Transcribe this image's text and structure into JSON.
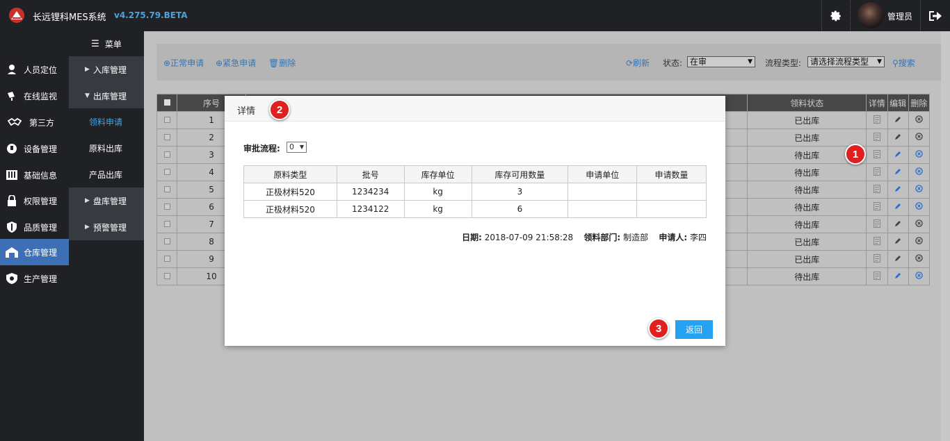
{
  "app": {
    "title": "长远锂科MES系统",
    "version": "v4.275.79.BETA",
    "user": "管理员"
  },
  "nav": [
    {
      "label": "人员定位",
      "icon": "person-pin-icon"
    },
    {
      "label": "在线监视",
      "icon": "monitor-icon"
    },
    {
      "label": "第三方",
      "icon": "handshake-icon"
    },
    {
      "label": "设备管理",
      "icon": "device-icon"
    },
    {
      "label": "基础信息",
      "icon": "columns-icon"
    },
    {
      "label": "权限管理",
      "icon": "lock-icon"
    },
    {
      "label": "品质管理",
      "icon": "shield-icon"
    },
    {
      "label": "仓库管理",
      "icon": "warehouse-icon"
    },
    {
      "label": "生产管理",
      "icon": "gear-shield-icon"
    }
  ],
  "submenu": {
    "header": "菜单",
    "groups": [
      {
        "label": "入库管理"
      },
      {
        "label": "出库管理"
      },
      {
        "label": "盘库管理"
      },
      {
        "label": "预警管理"
      }
    ],
    "children": [
      {
        "label": "领料申请"
      },
      {
        "label": "原料出库"
      },
      {
        "label": "产品出库"
      }
    ]
  },
  "toolbar": {
    "normal_apply": "正常申请",
    "urgent_apply": "紧急申请",
    "delete": "删除",
    "refresh": "刷新",
    "status_label": "状态:",
    "status_value": "在审",
    "flow_type_label": "流程类型:",
    "flow_type_value": "请选择流程类型",
    "search": "搜索"
  },
  "grid": {
    "headers": {
      "seq": "序号",
      "pick_status": "领料状态",
      "detail": "详情",
      "edit": "编辑",
      "delete": "删除"
    },
    "rows": [
      {
        "seq": "1",
        "status": "已出库"
      },
      {
        "seq": "2",
        "status": "已出库"
      },
      {
        "seq": "3",
        "status": "待出库"
      },
      {
        "seq": "4",
        "status": "待出库"
      },
      {
        "seq": "5",
        "status": "待出库"
      },
      {
        "seq": "6",
        "status": "待出库"
      },
      {
        "seq": "7",
        "status": "待出库"
      },
      {
        "seq": "8",
        "status": "已出库"
      },
      {
        "seq": "9",
        "status": "已出库"
      },
      {
        "seq": "10",
        "status": "待出库"
      }
    ]
  },
  "modal": {
    "title": "详情",
    "flow_label": "审批流程:",
    "flow_value": "0",
    "headers": [
      "原料类型",
      "批号",
      "库存单位",
      "库存可用数量",
      "申请单位",
      "申请数量"
    ],
    "rows": [
      [
        "正极材料520",
        "1234234",
        "kg",
        "3",
        "",
        ""
      ],
      [
        "正极材料520",
        "1234122",
        "kg",
        "6",
        "",
        ""
      ]
    ],
    "date_label": "日期:",
    "date_value": "2018-07-09 21:58:28",
    "dept_label": "领料部门:",
    "dept_value": "制造部",
    "applicant_label": "申请人:",
    "applicant_value": "李四",
    "return_label": "返回"
  },
  "badges": [
    "1",
    "2",
    "3"
  ],
  "colors": {
    "accent": "#26a2f2",
    "badge": "#e02020",
    "active_nav": "#3d6fb4"
  }
}
